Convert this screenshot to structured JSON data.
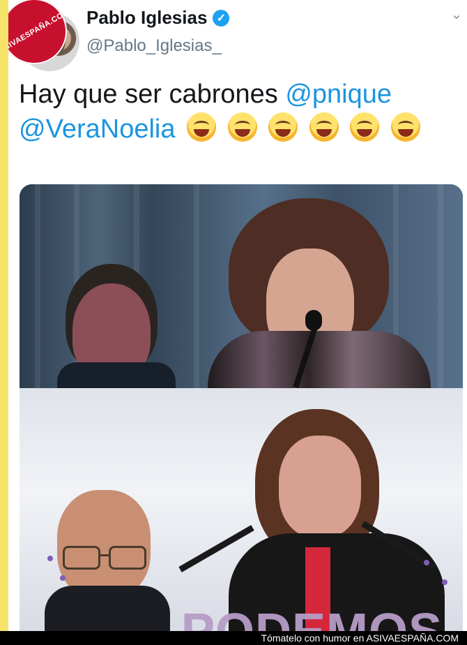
{
  "tweet": {
    "name": "Pablo Iglesias",
    "handle": "@Pablo_Iglesias_",
    "text": {
      "line1_prefix": "Hay que ser cabrones ",
      "mention1": "@pnique",
      "mention2": "@VeraNoelia"
    }
  },
  "media": {
    "podemos_text": "PODEMOS"
  },
  "branding": {
    "badge_text": "ASIVAESPAÑA.COM",
    "footer_text": "Tómatelo con humor en ASIVAESPAÑA.COM"
  },
  "colors": {
    "background": "#f6e36a",
    "mention": "#1b95e0",
    "verified": "#1da1f2"
  },
  "icons": {
    "verified": "verified-badge-icon",
    "menu": "chevron-down-icon",
    "emoji": "tears-of-joy-emoji-icon"
  }
}
